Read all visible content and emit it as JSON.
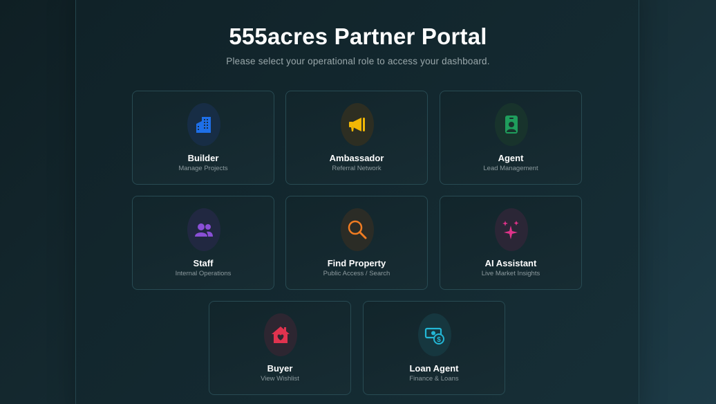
{
  "header": {
    "title": "555acres Partner Portal",
    "subtitle": "Please select your operational role to access your dashboard."
  },
  "roles": [
    {
      "title": "Builder",
      "subtitle": "Manage Projects",
      "icon": "building-icon",
      "color": "#1e6fe8",
      "bg": "#172d45"
    },
    {
      "title": "Ambassador",
      "subtitle": "Referral Network",
      "icon": "megaphone-icon",
      "color": "#f2b705",
      "bg": "#2d2e22"
    },
    {
      "title": "Agent",
      "subtitle": "Lead Management",
      "icon": "id-badge-icon",
      "color": "#1f9d5c",
      "bg": "#18332c"
    },
    {
      "title": "Staff",
      "subtitle": "Internal Operations",
      "icon": "users-icon",
      "color": "#8a4fd6",
      "bg": "#212841"
    },
    {
      "title": "Find Property",
      "subtitle": "Public Access / Search",
      "icon": "search-icon",
      "color": "#f07c22",
      "bg": "#2b2c26"
    },
    {
      "title": "AI Assistant",
      "subtitle": "Live Market Insights",
      "icon": "sparkles-icon",
      "color": "#e0338a",
      "bg": "#2b2636"
    },
    {
      "title": "Buyer",
      "subtitle": "View Wishlist",
      "icon": "home-heart-icon",
      "color": "#e0334f",
      "bg": "#2d2631"
    },
    {
      "title": "Loan Agent",
      "subtitle": "Finance & Loans",
      "icon": "money-icon",
      "color": "#23b7d6",
      "bg": "#16373f"
    }
  ]
}
